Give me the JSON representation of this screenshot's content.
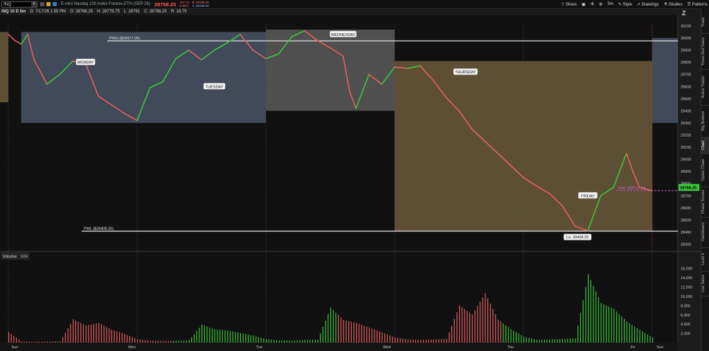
{
  "top_bar": {
    "symbol": "/NQ",
    "product": "E-mini Nasdaq 100 Index Futures,ETH (SEP 26)",
    "last_price": "28768.25",
    "change": "-257.75",
    "change_pct": "-0.89%",
    "bid": "B: 28768.25",
    "ask": "A: 28769.00",
    "toolbar": [
      "Share",
      "5m",
      "Style",
      "Drawings",
      "Studies",
      "Patterns"
    ]
  },
  "chart_header": {
    "title": "/NQ 15 D 5m",
    "date": "D: 7/17/26 1:55 PM",
    "open": "O: 28766.25",
    "high": "H: 28779.75",
    "low": "L: 28761",
    "close": "C: 28768.25",
    "range": "R: 18.75"
  },
  "colors": {
    "monday_tuesday_box": "#4a5566",
    "wednesday_box": "#5a5a5a",
    "thursday_friday_box": "#6b5a3a",
    "up_candle": "#3cc83c",
    "down_candle": "#e8605f",
    "price_tag": "#3cc83c",
    "pwc_line": "#d05ad0"
  },
  "chart_data": {
    "type": "line",
    "price_axis": {
      "ylim": [
        28240,
        30120
      ],
      "ticks": [
        "30100",
        "30000",
        "29900",
        "29800",
        "29700",
        "29600",
        "29500",
        "29400",
        "29300",
        "29200",
        "29100",
        "29000",
        "28900",
        "28800",
        "28700",
        "28600",
        "28500",
        "28400",
        "28300"
      ]
    },
    "x_labels": [
      "Sun",
      "Mon",
      "Tue",
      "Wed",
      "Thu",
      "Fri",
      "Sun"
    ],
    "price_tag": "28768.25",
    "day_labels": [
      "MONDAY",
      "TUESDAY",
      "WEDNESDAY",
      "THURSDAY",
      "FRIDAY"
    ],
    "levels": [
      {
        "label": "PWH ($29977.06)",
        "value": 29977.06
      },
      {
        "label": "PWL ($28408.25)",
        "value": 28408.25
      },
      {
        "label": "PWC ($28741.83)",
        "value": 28741.83
      }
    ],
    "low_callout": "Lo: 28408.25",
    "boxes": [
      {
        "name": "MON-TUE",
        "x_start": 0.1,
        "x_end": 2.0,
        "y_high": 30050,
        "y_low": 29300
      },
      {
        "name": "WED",
        "x_start": 2.0,
        "x_end": 3.0,
        "y_high": 30070,
        "y_low": 29400
      },
      {
        "name": "THU-FRI",
        "x_start": 3.0,
        "x_end": 5.0,
        "y_high": 29810,
        "y_low": 28410
      }
    ],
    "series": [
      {
        "name": "/NQ",
        "x": [
          0.0,
          0.05,
          0.1,
          0.15,
          0.2,
          0.3,
          0.4,
          0.5,
          0.6,
          0.7,
          0.8,
          0.9,
          1.0,
          1.1,
          1.2,
          1.3,
          1.4,
          1.5,
          1.6,
          1.7,
          1.8,
          1.9,
          2.0,
          2.1,
          2.2,
          2.3,
          2.4,
          2.5,
          2.6,
          2.65,
          2.7,
          2.8,
          2.9,
          3.0,
          3.1,
          3.2,
          3.3,
          3.4,
          3.5,
          3.6,
          3.7,
          3.8,
          3.9,
          4.0,
          4.1,
          4.2,
          4.3,
          4.4,
          4.5,
          4.6,
          4.7,
          4.8,
          4.85,
          4.9,
          5.0
        ],
        "values": [
          30030,
          29980,
          29950,
          30030,
          29820,
          29620,
          29700,
          29810,
          29790,
          29520,
          29450,
          29380,
          29320,
          29590,
          29640,
          29830,
          29900,
          29820,
          29900,
          29960,
          30030,
          29900,
          29830,
          29870,
          30010,
          30060,
          29980,
          29920,
          29850,
          29560,
          29420,
          29700,
          29620,
          29760,
          29750,
          29770,
          29650,
          29510,
          29400,
          29250,
          29150,
          29050,
          28950,
          28850,
          28780,
          28720,
          28620,
          28450,
          28410,
          28700,
          28770,
          29050,
          28900,
          28770,
          28740
        ]
      }
    ],
    "volume": {
      "name": "Volume",
      "value_label": "684",
      "ylim": [
        0,
        17000
      ],
      "ticks": [
        "16,000",
        "14,000",
        "12,000",
        "10,000",
        "8,000",
        "6,000",
        "4,000",
        "2,000"
      ],
      "x": [
        0.0,
        0.1,
        0.2,
        0.3,
        0.4,
        0.5,
        0.6,
        0.7,
        0.8,
        0.9,
        1.0,
        1.1,
        1.2,
        1.3,
        1.4,
        1.5,
        1.6,
        1.7,
        1.8,
        1.9,
        2.0,
        2.1,
        2.2,
        2.3,
        2.4,
        2.5,
        2.6,
        2.7,
        2.8,
        2.9,
        3.0,
        3.1,
        3.2,
        3.3,
        3.4,
        3.5,
        3.6,
        3.7,
        3.8,
        3.9,
        4.0,
        4.1,
        4.2,
        4.3,
        4.4,
        4.5,
        4.6,
        4.7,
        4.8,
        4.9,
        5.0
      ],
      "values": [
        6500,
        800,
        500,
        600,
        700,
        12000,
        8500,
        9500,
        6000,
        4000,
        1500,
        900,
        700,
        800,
        900,
        7000,
        5000,
        4500,
        3500,
        2500,
        1200,
        800,
        700,
        900,
        1000,
        11000,
        7000,
        6000,
        4500,
        3000,
        1500,
        900,
        800,
        900,
        1000,
        10000,
        7500,
        13000,
        6000,
        3500,
        1500,
        700,
        800,
        900,
        1100,
        16500,
        9500,
        8000,
        5000,
        3000,
        1200
      ]
    }
  },
  "right_tabs": [
    "Trade",
    "Times And Sales",
    "Active Trader",
    "Big Buttons",
    "Chart",
    "Option Chain",
    "Phase Scores",
    "Dashboard",
    "Level II",
    "Live News"
  ]
}
